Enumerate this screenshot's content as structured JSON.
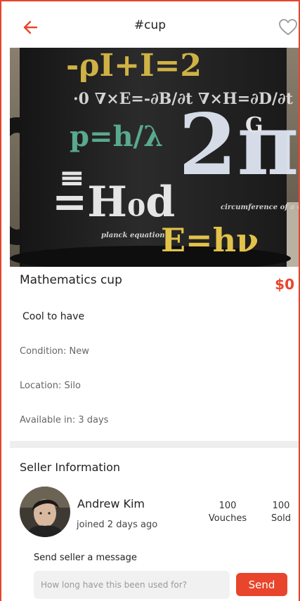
{
  "header": {
    "title": "#cup",
    "back_icon": "back-arrow-icon",
    "favorite_icon": "heart-icon"
  },
  "product": {
    "image_alt": "mug-photo",
    "name": "Mathematics cup",
    "price": "$0",
    "description": "Cool to have",
    "condition": "Condition: New",
    "location": "Location: Silo",
    "availability": "Available in: 3 days"
  },
  "seller": {
    "heading": "Seller Information",
    "name": "Andrew Kim",
    "joined": "joined 2 days ago",
    "vouches_count": "100",
    "vouches_label": "Vouches",
    "sold_count": "100",
    "sold_label": "Sold"
  },
  "message": {
    "label": "Send seller a message",
    "placeholder": "How long have this been used for?",
    "send_label": "Send"
  },
  "colors": {
    "accent": "#e8452c",
    "divider": "#eeeeee"
  }
}
